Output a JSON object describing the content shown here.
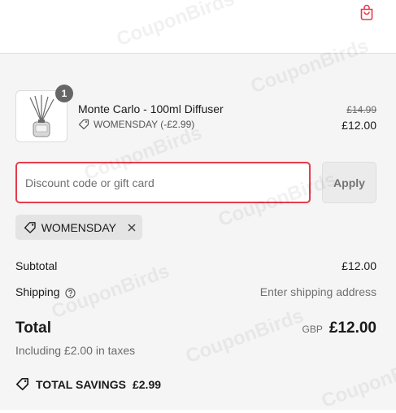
{
  "header": {
    "cart_icon": "shopping-bag-icon",
    "accent_color": "#e63b4c"
  },
  "line_item": {
    "quantity": "1",
    "name": "Monte Carlo - 100ml Diffuser",
    "discount_label": "WOMENSDAY (-£2.99)",
    "original_price": "£14.99",
    "price": "£12.00"
  },
  "discount_form": {
    "placeholder": "Discount code or gift card",
    "value": "",
    "apply_label": "Apply"
  },
  "applied_code": {
    "label": "WOMENSDAY"
  },
  "totals": {
    "subtotal_label": "Subtotal",
    "subtotal_value": "£12.00",
    "shipping_label": "Shipping",
    "shipping_value": "Enter shipping address",
    "total_label": "Total",
    "currency": "GBP",
    "total_value": "£12.00",
    "taxes_note": "Including £2.00 in taxes",
    "savings_label": "TOTAL SAVINGS",
    "savings_value": "£2.99"
  },
  "watermark_text": "CouponBirds"
}
